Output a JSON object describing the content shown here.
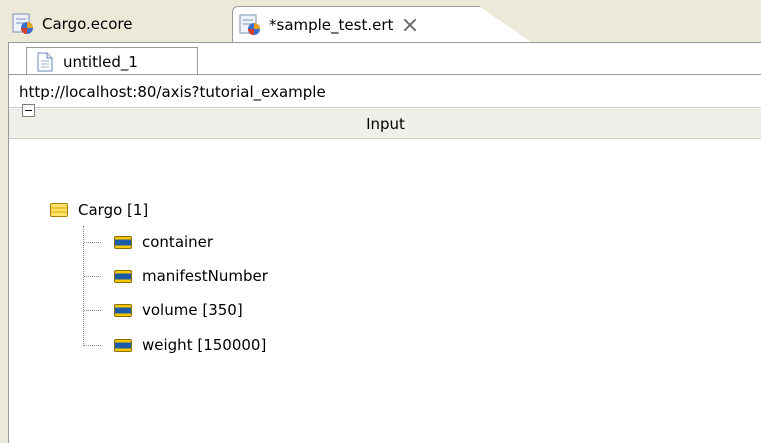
{
  "editor_tabs": [
    {
      "label": "Cargo.ecore",
      "icon": "ecore-model-icon",
      "active": false
    },
    {
      "label": "*sample_test.ert",
      "icon": "ert-file-icon",
      "active": true
    }
  ],
  "subtab": {
    "label": "untitled_1",
    "icon": "document-icon"
  },
  "url": "http://localhost:80/axis?tutorial_example",
  "input_header": "Input",
  "tree": {
    "root": {
      "label": "Cargo [1]",
      "icon": "eclass-icon",
      "expanded": true
    },
    "children": [
      {
        "label": "container",
        "icon": "eattribute-icon"
      },
      {
        "label": "manifestNumber",
        "icon": "eattribute-icon"
      },
      {
        "label": "volume [350]",
        "icon": "eattribute-icon"
      },
      {
        "label": "weight [150000]",
        "icon": "eattribute-icon"
      }
    ]
  },
  "colors": {
    "chrome": "#ece9d8",
    "attribute_icon_blue": "#1c5ba8",
    "class_icon_yellow": "#ffe26a"
  }
}
